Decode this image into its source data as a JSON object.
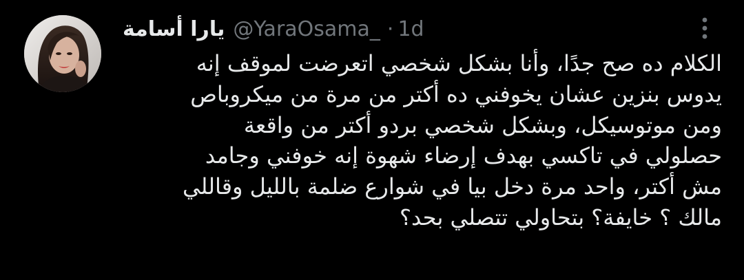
{
  "tweet": {
    "display_name": "يارا أسامة",
    "handle": "@YaraOsama_",
    "separator": "·",
    "time": "1d",
    "more_icon": "more-options-vertical-icon",
    "avatar_icon": "user-avatar",
    "text_lines": [
      "الكلام ده صح جدًا، وأنا بشكل شخصي اتعرضت لموقف إنه",
      "يدوس بنزين عشان يخوفني ده أكتر من مرة من ميكروباص",
      "ومن موتوسيكل، وبشكل شخصي بردو أكتر من واقعة",
      "حصلولي في تاكسي بهدف إرضاء شهوة إنه خوفني وجامد",
      "مش أكتر، واحد مرة دخل بيا في شوارع ضلمة بالليل وقاللي",
      "مالك ؟ خايفة؟ بتحاولي تتصلي بحد؟"
    ]
  },
  "colors": {
    "background": "#000000",
    "primary_text": "#e7e9ea",
    "secondary_text": "#71767b"
  }
}
